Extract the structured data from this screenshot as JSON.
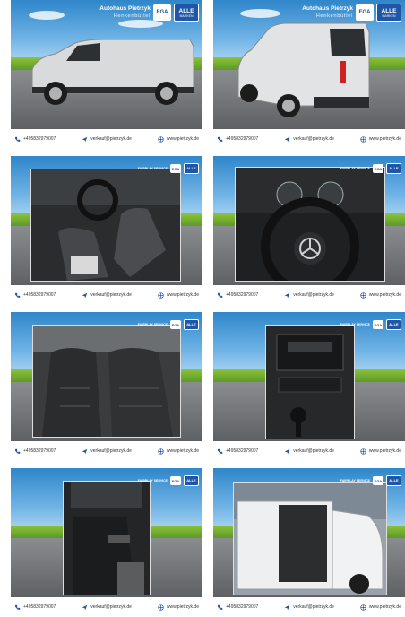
{
  "dealer": {
    "name": "Autohaus Pietrzyk",
    "tagline": "Henkenbüttel",
    "badge_ega": "EGA",
    "badge_alle": "ALLE",
    "badge_marken": "MARKEN",
    "badge_small": "FAIRPLAY SERVICE"
  },
  "contact": {
    "phone": "+495832979007",
    "email": "verkauf@pietrzyk.de",
    "web": "www.pietrzyk.de"
  },
  "icons": [
    "phone-icon",
    "send-icon",
    "globe-icon"
  ],
  "colors": {
    "sky": "#2f86c9",
    "grass": "#6fab2e",
    "road": "#6e7174",
    "brand_blue": "#1f56a8"
  },
  "listing_images": [
    {
      "subject": "van-side-view"
    },
    {
      "subject": "van-rear-three-quarter"
    },
    {
      "subject": "cabin-seats"
    },
    {
      "subject": "steering-wheel-dashboard"
    },
    {
      "subject": "front-seats"
    },
    {
      "subject": "center-console-radio"
    },
    {
      "subject": "door-panel"
    },
    {
      "subject": "van-open-sliding-door"
    }
  ]
}
